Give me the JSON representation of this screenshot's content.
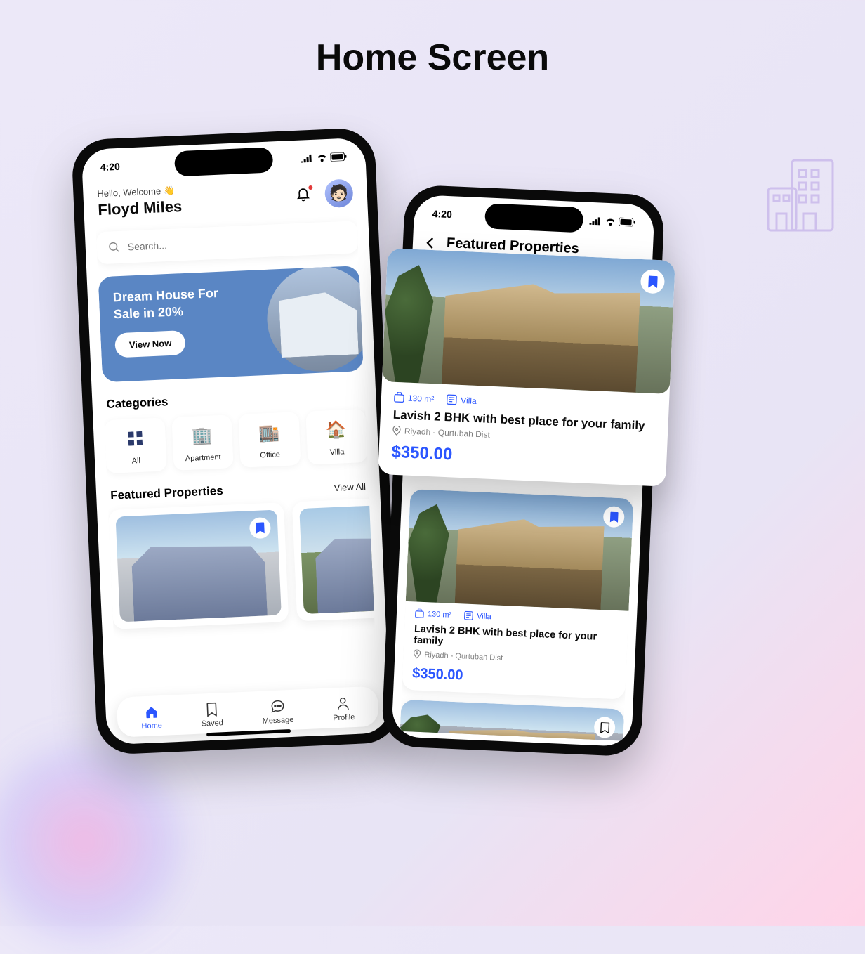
{
  "page_title": "Home Screen",
  "status_time": "4:20",
  "home": {
    "greeting": "Hello, Welcome 👋",
    "username": "Floyd Miles",
    "search_placeholder": "Search...",
    "promo": {
      "title_l1": "Dream House For",
      "title_l2": "Sale in 20%",
      "cta": "View Now"
    },
    "categories_title": "Categories",
    "categories": [
      {
        "icon": "grid",
        "label": "All"
      },
      {
        "icon": "apartment",
        "label": "Apartment"
      },
      {
        "icon": "office",
        "label": "Office"
      },
      {
        "icon": "villa",
        "label": "Villa"
      }
    ],
    "featured_title": "Featured Properties",
    "view_all": "View All",
    "nav": [
      {
        "label": "Home",
        "active": true
      },
      {
        "label": "Saved",
        "active": false
      },
      {
        "label": "Message",
        "active": false
      },
      {
        "label": "Profile",
        "active": false
      }
    ]
  },
  "list": {
    "title": "Featured Properties",
    "cards": [
      {
        "area": "130 m²",
        "type": "Villa",
        "title": "Lavish 2 BHK with best place for your family",
        "location": "Riyadh - Qurtubah Dist",
        "price": "$350.00"
      },
      {
        "area": "130 m²",
        "type": "Villa",
        "title": "Lavish 2 BHK with best place for your family",
        "location": "Riyadh - Qurtubah Dist",
        "price": "$350.00"
      }
    ]
  },
  "highlight": {
    "area": "130 m²",
    "type": "Villa",
    "title": "Lavish 2 BHK with best place for your family",
    "location": "Riyadh - Qurtubah Dist",
    "price": "$350.00"
  }
}
